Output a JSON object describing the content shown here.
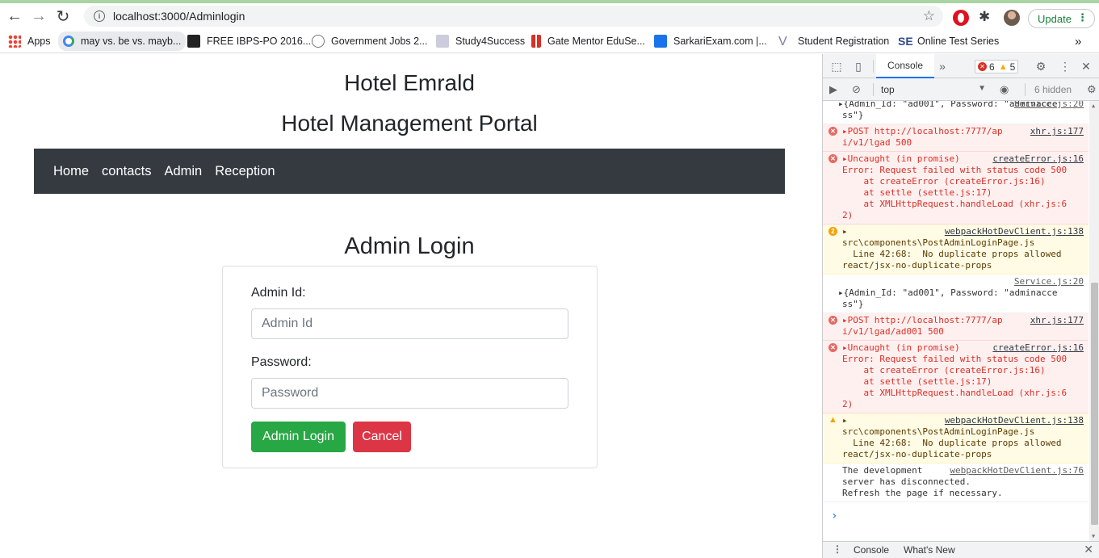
{
  "browser": {
    "url": "localhost:3000/Adminlogin",
    "update_label": "Update",
    "bookmarks": {
      "apps": "Apps",
      "b1": "may vs. be vs. mayb...",
      "b2": "FREE IBPS-PO 2016...",
      "b3": "Government Jobs 2...",
      "b4": "Study4Success",
      "b5": "Gate Mentor EduSe...",
      "b6": "SarkariExam.com |...",
      "b7": "Student Registration",
      "b8": "Online Test Series",
      "more": "»"
    }
  },
  "page": {
    "hotel_name": "Hotel Emrald",
    "portal_title": "Hotel Management Portal",
    "nav": [
      "Home",
      "contacts",
      "Admin",
      "Reception"
    ],
    "login_title": "Admin Login",
    "form": {
      "admin_id_label": "Admin Id:",
      "admin_id_placeholder": "Admin Id",
      "admin_id_value": "",
      "password_label": "Password:",
      "password_placeholder": "Password",
      "password_value": "",
      "login_button": "Admin Login",
      "cancel_button": "Cancel"
    }
  },
  "devtools": {
    "tab": "Console",
    "error_count": "6",
    "warning_count": "5",
    "context": "top",
    "hidden": "6 hidden",
    "drawer_tabs": [
      "Console",
      "What's New"
    ],
    "messages": [
      {
        "type": "log",
        "source": "Service.js:20",
        "lines": [
          "{Admin_Id: \"ad001\", Password: \"adminacce",
          "ss\"}"
        ],
        "partial": true
      },
      {
        "type": "error",
        "source": "xhr.js:177",
        "lines": [
          "POST http://localhost:7777/ap",
          "i/v1/lgad 500"
        ]
      },
      {
        "type": "error",
        "source": "createError.js:16",
        "lines": [
          "Uncaught (in promise)",
          "Error: Request failed with status code 500",
          "    at createError (createError.js:16)",
          "    at settle (settle.js:17)",
          "    at XMLHttpRequest.handleLoad (xhr.js:6",
          "2)"
        ]
      },
      {
        "type": "warning",
        "count": "2",
        "source": "webpackHotDevClient.js:138",
        "lines": [
          "",
          "src\\components\\PostAdminLoginPage.js",
          "  Line 42:68:  No duplicate props allowed",
          "react/jsx-no-duplicate-props"
        ]
      },
      {
        "type": "log",
        "source": "Service.js:20",
        "lines": [
          "",
          "{Admin_Id: \"ad001\", Password: \"adminacce",
          "ss\"}"
        ]
      },
      {
        "type": "error",
        "source": "xhr.js:177",
        "lines": [
          "POST http://localhost:7777/ap",
          "i/v1/lgad/ad001 500"
        ]
      },
      {
        "type": "error",
        "source": "createError.js:16",
        "lines": [
          "Uncaught (in promise)",
          "Error: Request failed with status code 500",
          "    at createError (createError.js:16)",
          "    at settle (settle.js:17)",
          "    at XMLHttpRequest.handleLoad (xhr.js:6",
          "2)"
        ]
      },
      {
        "type": "warning",
        "count": "",
        "source": "webpackHotDevClient.js:138",
        "lines": [
          "",
          "src\\components\\PostAdminLoginPage.js",
          "  Line 42:68:  No duplicate props allowed",
          "react/jsx-no-duplicate-props"
        ]
      },
      {
        "type": "log",
        "source": "webpackHotDevClient.js:76",
        "lines": [
          "The development",
          "server has disconnected.",
          "Refresh the page if necessary."
        ]
      }
    ]
  }
}
